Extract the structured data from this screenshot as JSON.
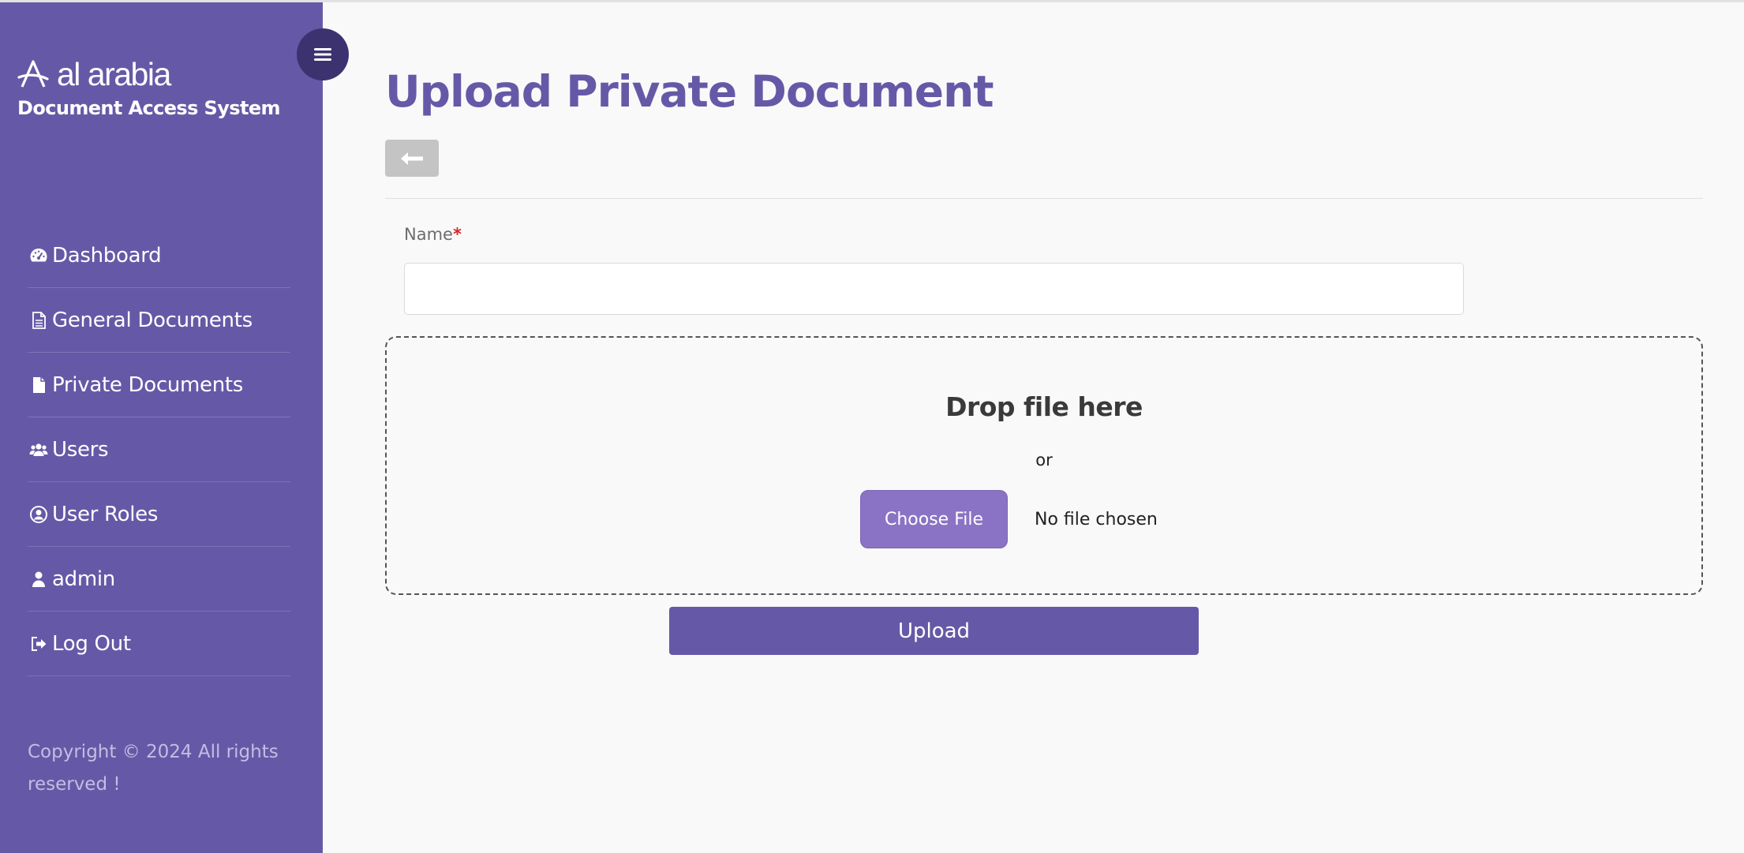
{
  "sidebar": {
    "logo_text": "al arabia",
    "subtitle": "Document Access System",
    "toggle_icon": "hamburger-menu-icon",
    "items": [
      {
        "label": "Dashboard",
        "icon": "dashboard-gauge-icon"
      },
      {
        "label": "General Documents",
        "icon": "document-outline-icon"
      },
      {
        "label": "Private Documents",
        "icon": "document-solid-icon"
      },
      {
        "label": "Users",
        "icon": "users-group-icon"
      },
      {
        "label": "User Roles",
        "icon": "user-circle-icon"
      },
      {
        "label": "admin",
        "icon": "user-icon"
      },
      {
        "label": "Log Out",
        "icon": "logout-icon"
      }
    ],
    "copyright": "Copyright © 2024 All rights reserved !"
  },
  "main": {
    "title": "Upload Private Document",
    "back_icon": "arrow-left-icon",
    "form": {
      "name_label": "Name",
      "required_mark": "*",
      "name_value": "",
      "dropzone_title": "Drop file here",
      "dropzone_or": "or",
      "choose_file_label": "Choose File",
      "file_status": "No file chosen",
      "upload_label": "Upload"
    }
  },
  "colors": {
    "primary": "#6559a7",
    "toggle_bg": "#3d3270",
    "choose_file_bg": "#8a73c5",
    "required": "#d9232b"
  }
}
